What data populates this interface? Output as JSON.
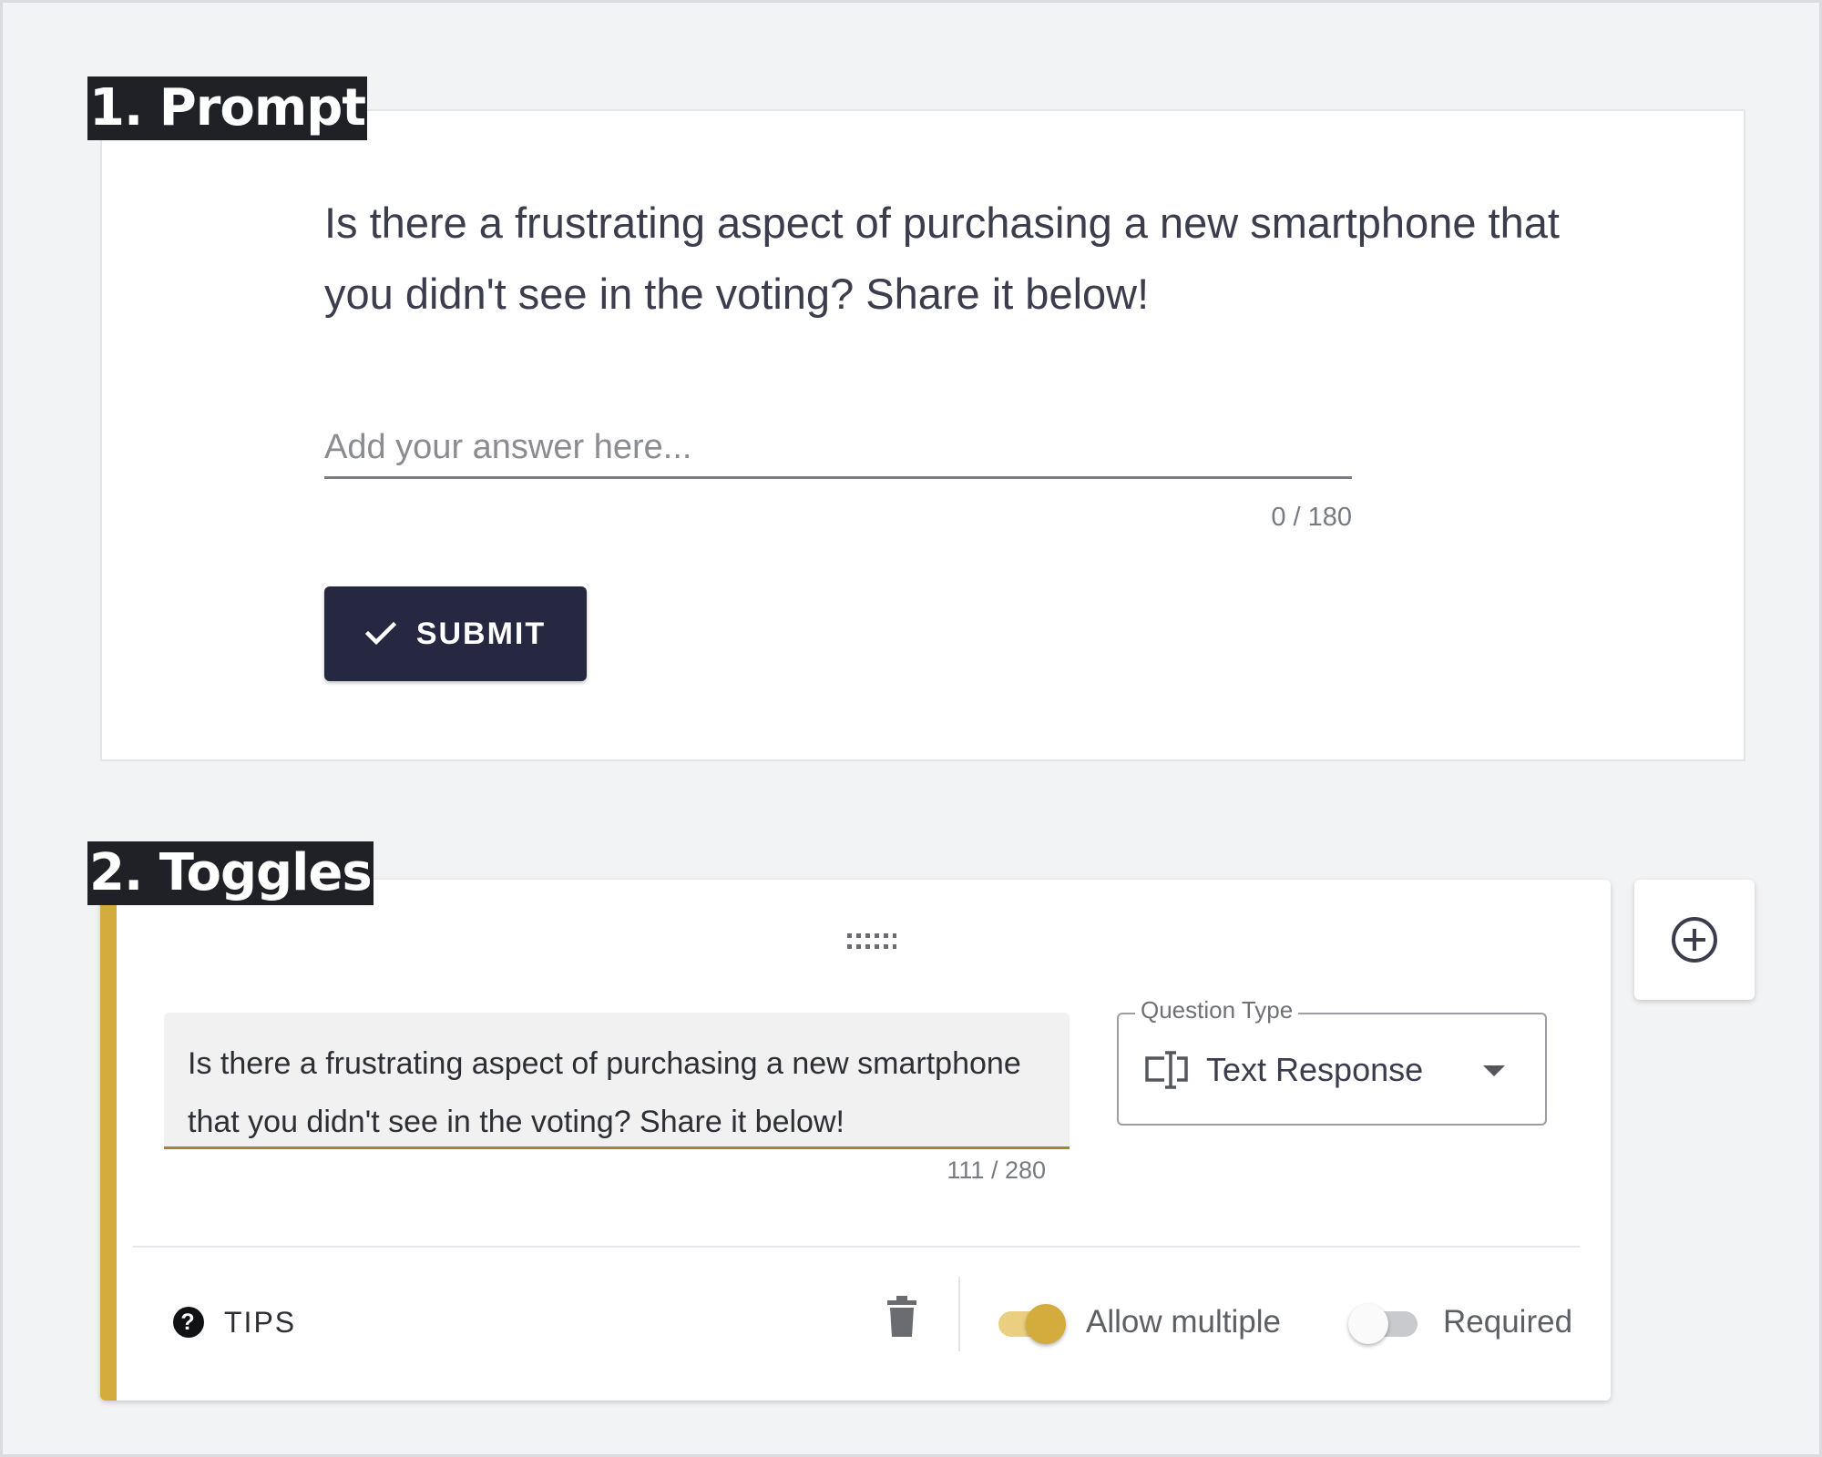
{
  "sections": {
    "prompt_label": "1. Prompt",
    "toggles_label": "2. Toggles"
  },
  "prompt": {
    "question": "Is there a frustrating aspect of purchasing a new smartphone that you didn't see in the voting? Share it below!",
    "answer_placeholder": "Add your answer here...",
    "answer_value": "",
    "counter": "0 / 180",
    "submit_label": "SUBMIT",
    "submit_icon": "check-icon"
  },
  "editor": {
    "question_text": "Is there a frustrating aspect of purchasing a new smartphone that you didn't see in the voting? Share it below!",
    "counter": "111 / 280",
    "question_type_label": "Question Type",
    "question_type_value": "Text Response",
    "tips_label": "TIPS",
    "allow_multiple_label": "Allow multiple",
    "allow_multiple_on": true,
    "required_label": "Required",
    "required_on": false,
    "icons": [
      "drag-handle-icon",
      "text-field-icon",
      "chevron-down-icon",
      "help-icon",
      "trash-icon",
      "add-circle-icon"
    ]
  },
  "colors": {
    "accent": "#d4ab3d",
    "submit_bg": "#262842",
    "background": "#f2f3f5"
  }
}
